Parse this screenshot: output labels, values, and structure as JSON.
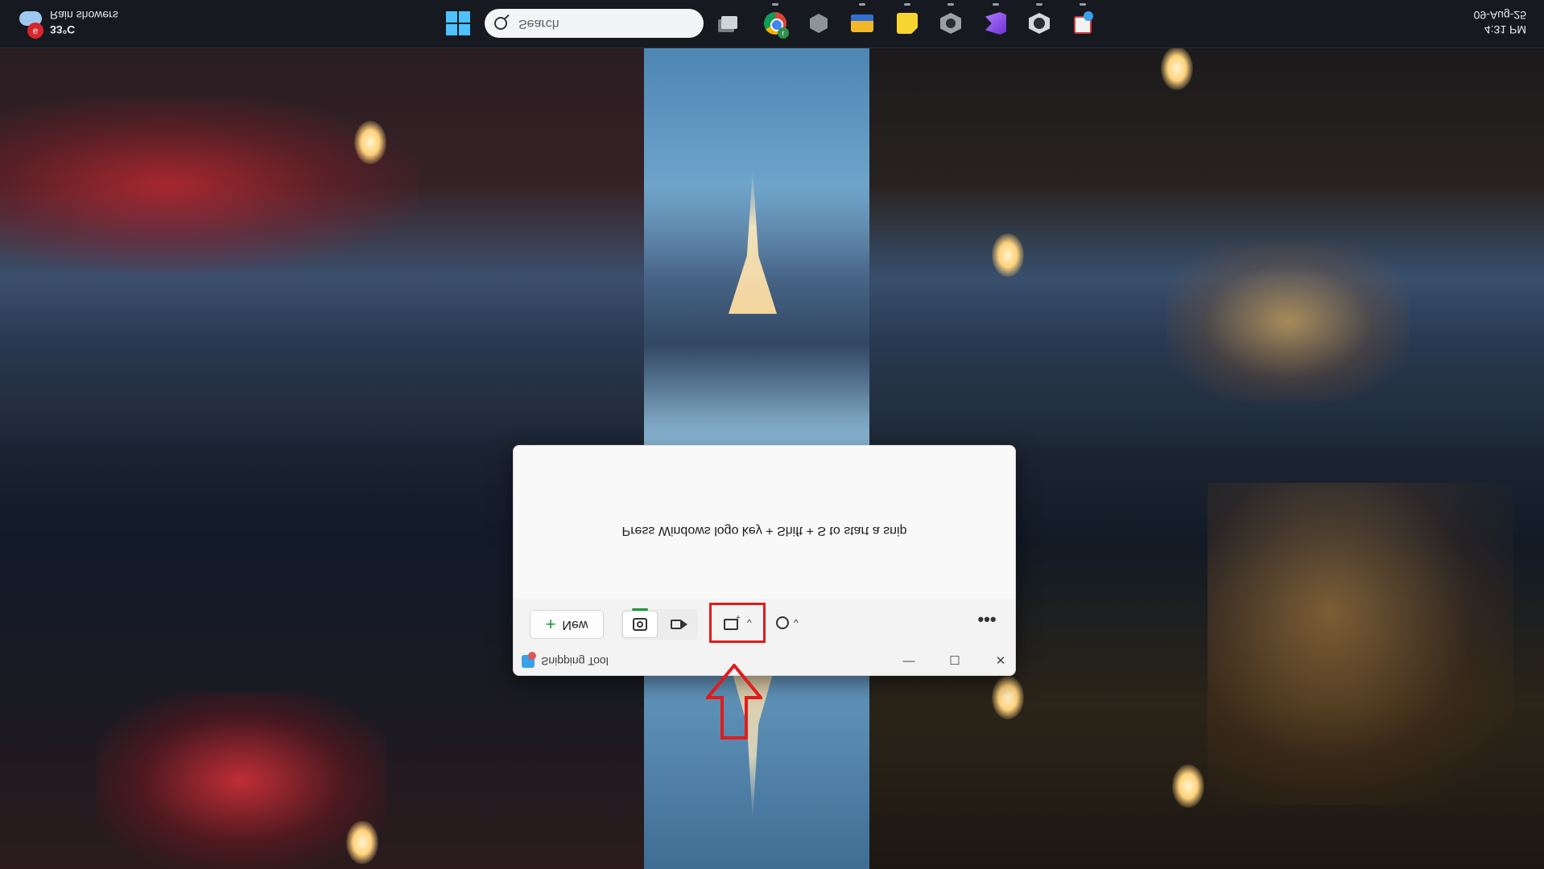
{
  "taskbar": {
    "weather": {
      "condition": "Rain showers",
      "temperature": "33°C",
      "badge": "e"
    },
    "search_placeholder": "Search",
    "apps": [
      {
        "name": "task-view",
        "icon": "task-view-icon"
      },
      {
        "name": "chrome",
        "icon": "chrome-icon",
        "badge": "r"
      },
      {
        "name": "3d-cube-app",
        "icon": "cube-icon"
      },
      {
        "name": "file-explorer",
        "icon": "folder-icon"
      },
      {
        "name": "sticky-notes",
        "icon": "sticky-notes-icon"
      },
      {
        "name": "hex-app",
        "icon": "hexagon-icon"
      },
      {
        "name": "visual-studio",
        "icon": "visual-studio-icon"
      },
      {
        "name": "settings",
        "icon": "gear-icon"
      },
      {
        "name": "snipping-tool",
        "icon": "snipping-tool-icon"
      }
    ],
    "clock": {
      "time": "4:31 PM",
      "date": "09-Aug-25"
    }
  },
  "snipping_tool": {
    "title": "Snipping Tool",
    "hint": "Press Windows logo key + Shift + S to start a snip",
    "toolbar": {
      "new_label": "New",
      "modes": [
        "snip",
        "record"
      ],
      "selected_mode": "snip",
      "shape_icon": "rectangle-snip-icon",
      "delay_icon": "timer-icon",
      "more_glyph": "•••"
    },
    "window_controls": {
      "minimize": "—",
      "maximize": "☐",
      "close": "✕"
    }
  },
  "annotation": {
    "arrow_color": "#e01c1c",
    "highlight_color": "#e01c1c"
  }
}
